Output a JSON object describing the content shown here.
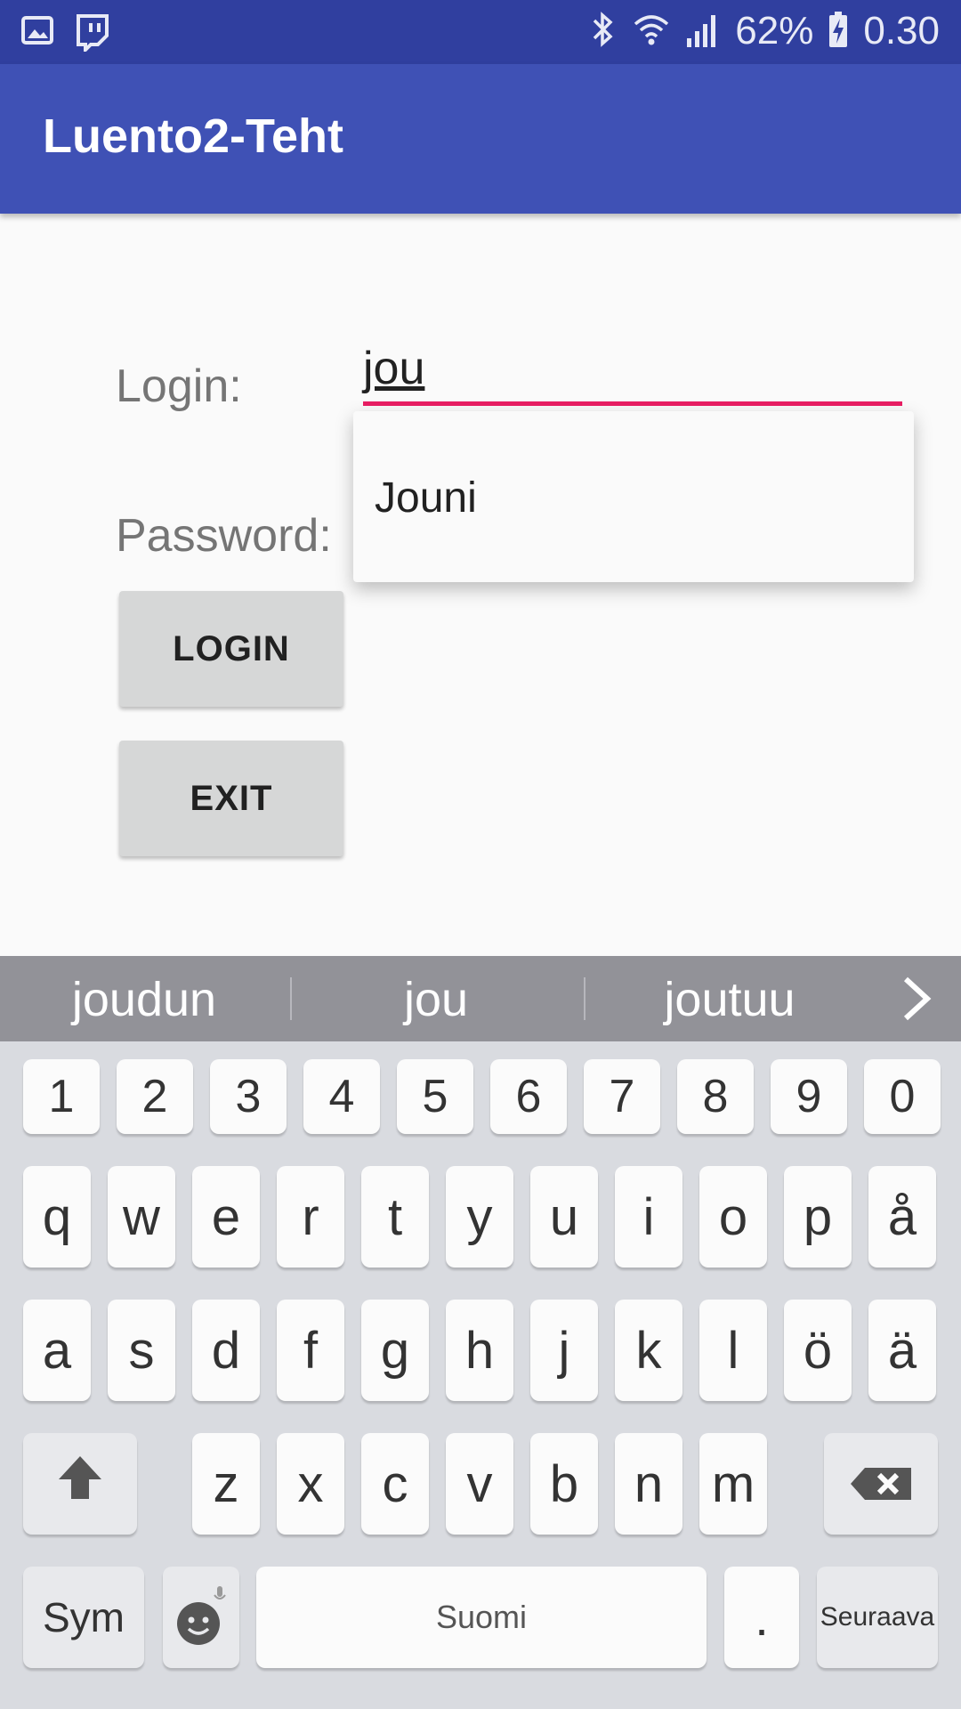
{
  "status_bar": {
    "battery": "62%",
    "time": "0.30",
    "icons_left": [
      "image-icon",
      "twitch-icon"
    ],
    "icons_right": [
      "bluetooth-icon",
      "wifi-icon",
      "signal-icon",
      "battery-charging-icon"
    ]
  },
  "app_bar": {
    "title": "Luento2-Teht"
  },
  "form": {
    "login_label": "Login:",
    "login_value": "jou",
    "password_label": "Password:",
    "autocomplete": [
      "Jouni"
    ],
    "login_button": "LOGIN",
    "exit_button": "EXIT"
  },
  "keyboard": {
    "suggestions": [
      "joudun",
      "jou",
      "joutuu"
    ],
    "row_numbers": [
      "1",
      "2",
      "3",
      "4",
      "5",
      "6",
      "7",
      "8",
      "9",
      "0"
    ],
    "row1": [
      "q",
      "w",
      "e",
      "r",
      "t",
      "y",
      "u",
      "i",
      "o",
      "p",
      "å"
    ],
    "row2": [
      "a",
      "s",
      "d",
      "f",
      "g",
      "h",
      "j",
      "k",
      "l",
      "ö",
      "ä"
    ],
    "row3": [
      "z",
      "x",
      "c",
      "v",
      "b",
      "n",
      "m"
    ],
    "sym": "Sym",
    "space": "Suomi",
    "period": ".",
    "next": "Seuraava"
  },
  "colors": {
    "status_bar": "#303f9f",
    "app_bar": "#3f51b5",
    "accent": "#e91e63"
  }
}
